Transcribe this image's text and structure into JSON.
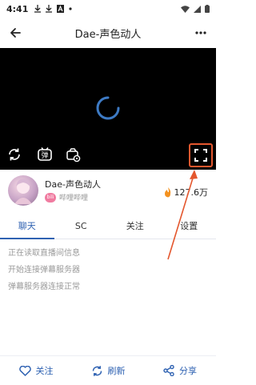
{
  "status_bar": {
    "time": "4:41",
    "left_icons": [
      "download-icon",
      "download-icon",
      "font-icon",
      "dot-icon"
    ],
    "right_icons": [
      "wifi-icon",
      "signal-icon",
      "battery-icon"
    ]
  },
  "app_bar": {
    "title": "Dae-声色动人",
    "back_icon": "arrow-left-icon",
    "more_icon": "more-vertical-icon"
  },
  "player": {
    "state": "loading",
    "controls": [
      "refresh-icon",
      "danmaku-toggle-icon",
      "settings-icon",
      "fullscreen-icon"
    ],
    "danmaku_label": "弹",
    "highlight_color": "#e4572e"
  },
  "streamer": {
    "name": "Dae-声色动人",
    "platform_badge": "bili",
    "platform": "哔哩哔哩",
    "popularity": "127.6万",
    "popularity_icon": "flame-icon"
  },
  "tabs": [
    {
      "label": "聊天",
      "active": true
    },
    {
      "label": "SC",
      "active": false
    },
    {
      "label": "关注",
      "active": false
    },
    {
      "label": "设置",
      "active": false
    }
  ],
  "messages": [
    "正在读取直播间信息",
    "开始连接弹幕服务器",
    "弹幕服务器连接正常"
  ],
  "bottom_actions": [
    {
      "label": "关注",
      "icon": "heart-icon"
    },
    {
      "label": "刷新",
      "icon": "refresh-icon"
    },
    {
      "label": "分享",
      "icon": "share-icon"
    }
  ],
  "colors": {
    "accent": "#2f62b2",
    "annotation": "#e4572e"
  }
}
